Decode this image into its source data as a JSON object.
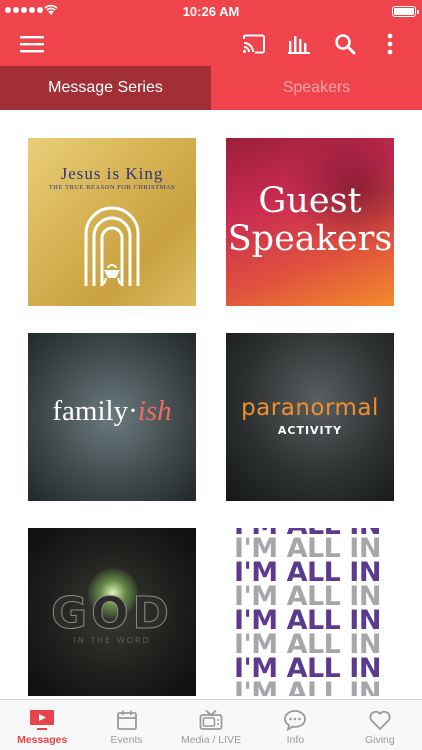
{
  "status_bar": {
    "time": "10:26 AM",
    "signal_icon": "signal-dots-icon",
    "wifi_icon": "wifi-icon",
    "battery_icon": "battery-icon",
    "battery_level": 1.0
  },
  "app_bar": {
    "menu_icon": "hamburger-menu-icon",
    "cast_icon": "cast-icon",
    "audio_icon": "audio-bars-icon",
    "search_icon": "search-icon",
    "more_icon": "more-vertical-icon",
    "background_color": "#f0444c"
  },
  "tabs": [
    {
      "label": "Message Series",
      "active": true
    },
    {
      "label": "Speakers",
      "active": false
    }
  ],
  "series": [
    {
      "title": "Jesus is King",
      "subtitle": "THE TRUE REASON FOR CHRISTMAS"
    },
    {
      "title_line1": "Guest",
      "title_line2": "Speakers"
    },
    {
      "title": "family",
      "dot": "·",
      "accent": "ish"
    },
    {
      "title": "paranormal",
      "subtitle": "ACTIVITY"
    },
    {
      "title": "GOD",
      "subtitle": "IN THE WORD"
    },
    {
      "rows": [
        "I'M ALL IN",
        "I'M ALL IN",
        "I'M ALL IN",
        "I'M ALL IN",
        "I'M ALL IN",
        "I'M ALL IN",
        "I'M ALL IN",
        "I'M ALL IN"
      ]
    }
  ],
  "tab_bar": {
    "items": [
      {
        "label": "Messages",
        "icon": "tv-play-icon",
        "active": true
      },
      {
        "label": "Events",
        "icon": "calendar-icon",
        "active": false
      },
      {
        "label": "Media / LIVE",
        "icon": "television-icon",
        "active": false
      },
      {
        "label": "Info",
        "icon": "chat-bubble-icon",
        "active": false
      },
      {
        "label": "Giving",
        "icon": "heart-icon",
        "active": false
      }
    ],
    "active_color": "#e8434a",
    "inactive_color": "#9a9a9a"
  }
}
